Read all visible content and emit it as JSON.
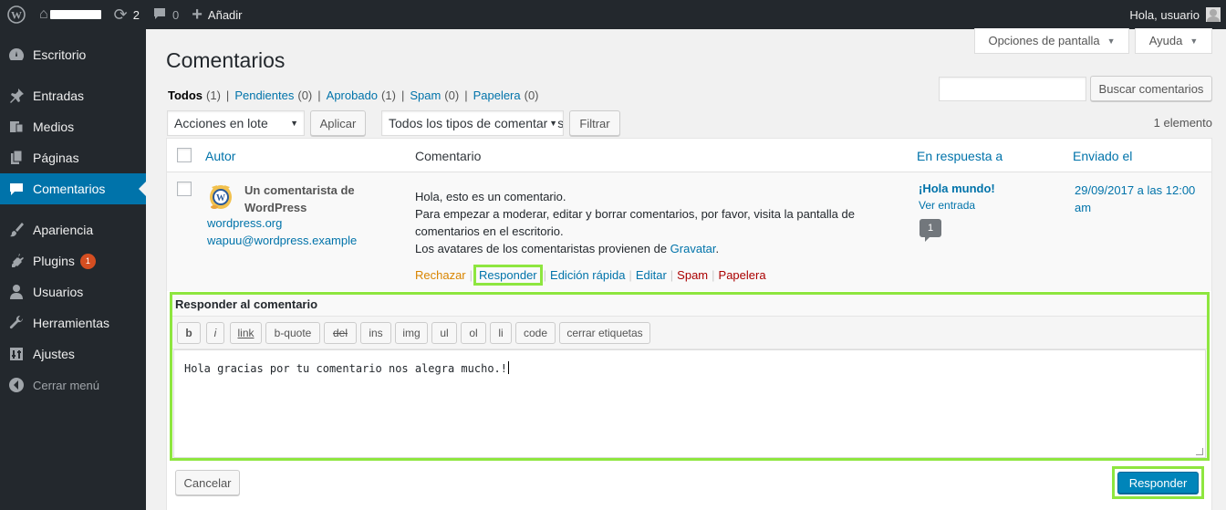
{
  "adminbar": {
    "updates_count": "2",
    "comments_count": "0",
    "new_label": "Añadir",
    "greeting": "Hola, usuario"
  },
  "sidebar": {
    "items": [
      {
        "label": "Escritorio",
        "icon": "dashboard-icon"
      },
      {
        "label": "Entradas",
        "icon": "pin-icon"
      },
      {
        "label": "Medios",
        "icon": "media-icon"
      },
      {
        "label": "Páginas",
        "icon": "page-icon"
      },
      {
        "label": "Comentarios",
        "icon": "comment-icon",
        "current": true
      },
      {
        "label": "Apariencia",
        "icon": "brush-icon"
      },
      {
        "label": "Plugins",
        "icon": "plug-icon",
        "badge": "1"
      },
      {
        "label": "Usuarios",
        "icon": "user-icon"
      },
      {
        "label": "Herramientas",
        "icon": "wrench-icon"
      },
      {
        "label": "Ajustes",
        "icon": "settings-icon"
      },
      {
        "label": "Cerrar menú",
        "icon": "collapse-icon"
      }
    ],
    "accent_color": "#0073aa"
  },
  "screen_meta": {
    "screen_options": "Opciones de pantalla",
    "help": "Ayuda"
  },
  "page_title": "Comentarios",
  "filters": {
    "all": "Todos",
    "all_count": "(1)",
    "pending": "Pendientes",
    "pending_count": "(0)",
    "approved": "Aprobado",
    "approved_count": "(1)",
    "spam": "Spam",
    "spam_count": "(0)",
    "trash": "Papelera",
    "trash_count": "(0)"
  },
  "search": {
    "value": "",
    "button": "Buscar comentarios"
  },
  "bulk": {
    "actions_selected": "Acciones en lote",
    "apply": "Aplicar",
    "type_selected": "Todos los tipos de comentarios",
    "filter": "Filtrar"
  },
  "items_count": "1 elemento",
  "table": {
    "headers": {
      "author": "Autor",
      "comment": "Comentario",
      "in_response_to": "En respuesta a",
      "submitted": "Enviado el"
    },
    "row": {
      "author_name": "Un comentarista de WordPress",
      "author_url": "wordpress.org",
      "author_email": "wapuu@wordpress.example",
      "comment_lines": [
        "Hola, esto es un comentario.",
        "Para empezar a moderar, editar y borrar comentarios, por favor, visita la pantalla de comentarios en el escritorio."
      ],
      "comment_last_prefix": "Los avatares de los comentaristas provienen de ",
      "comment_last_link": "Gravatar",
      "comment_last_suffix": ".",
      "actions": {
        "unapprove": "Rechazar",
        "reply": "Responder",
        "quick_edit": "Edición rápida",
        "edit": "Editar",
        "spam": "Spam",
        "trash": "Papelera"
      },
      "post_title": "¡Hola mundo!",
      "view_post": "Ver entrada",
      "post_comment_count": "1",
      "date": "29/09/2017 a las 12:00 am"
    }
  },
  "reply": {
    "title": "Responder al comentario",
    "toolbar": [
      "b",
      "i",
      "link",
      "b-quote",
      "del",
      "ins",
      "img",
      "ul",
      "ol",
      "li",
      "code",
      "cerrar etiquetas"
    ],
    "text": "Hola gracias por tu comentario nos alegra mucho.!",
    "cancel": "Cancelar",
    "submit": "Responder"
  },
  "colors": {
    "highlight": "#8ee63f",
    "primary_button": "#0085ba"
  }
}
